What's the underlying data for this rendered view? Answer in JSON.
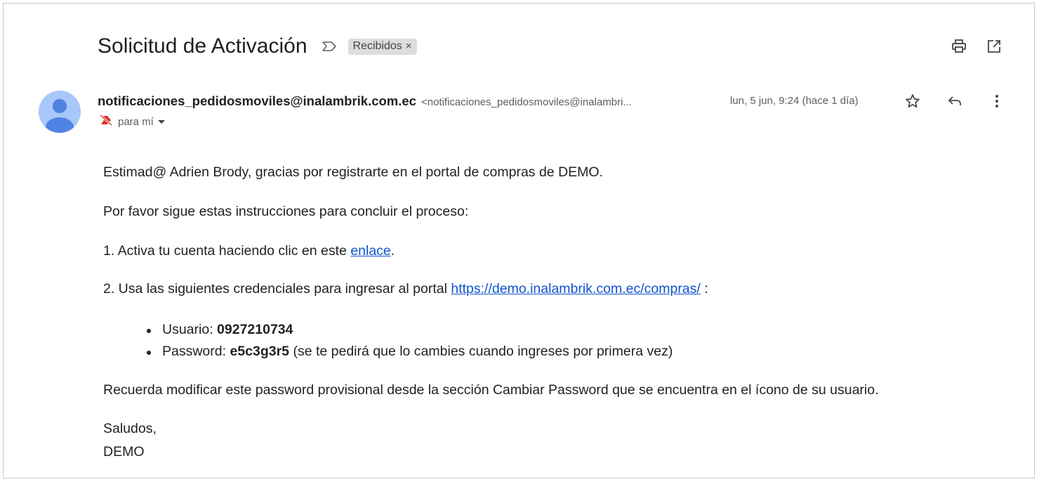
{
  "email": {
    "subject": "Solicitud de Activación",
    "label": "Recibidos",
    "label_close": "×",
    "sender_name": "notificaciones_pedidosmoviles@inalambrik.com.ec",
    "sender_email": "<notificaciones_pedidosmoviles@inalambri...",
    "date": "lun, 5 jun, 9:24 (hace 1 día)",
    "to": "para mí"
  },
  "body": {
    "greeting": "Estimad@ Adrien Brody, gracias por registrarte en el portal de compras de DEMO.",
    "instructions": "Por favor sigue estas instrucciones para concluir el proceso:",
    "step1_prefix": "1. Activa tu cuenta haciendo clic en este ",
    "step1_link": "enlace",
    "step1_suffix": ".",
    "step2_prefix": "2. Usa las siguientes credenciales para ingresar al portal ",
    "step2_link": "https://demo.inalambrik.com.ec/compras/",
    "step2_suffix": " :",
    "user_label": "Usuario: ",
    "user_value": "0927210734",
    "password_label": "Password: ",
    "password_value": "e5c3g3r5",
    "password_note": " (se te pedirá que lo cambies cuando ingreses por primera vez)",
    "reminder": "Recuerda modificar este password provisional desde la sección Cambiar Password que se encuentra en el ícono de su usuario.",
    "closing": "Saludos,",
    "signature": "DEMO"
  },
  "icons": {
    "important": "important-marker-icon",
    "print": "print-icon",
    "popout": "open-in-new-window-icon",
    "star": "star-icon",
    "reply": "reply-icon",
    "more": "more-vert-icon",
    "avatar": "person-avatar-icon",
    "not_important": "not-important-icon"
  },
  "colors": {
    "link": "#1155cc",
    "avatar_bg": "#a8c7fa",
    "avatar_fg": "#4f83e3",
    "label_bg": "#dddddd",
    "not_important_red": "#d93025"
  }
}
